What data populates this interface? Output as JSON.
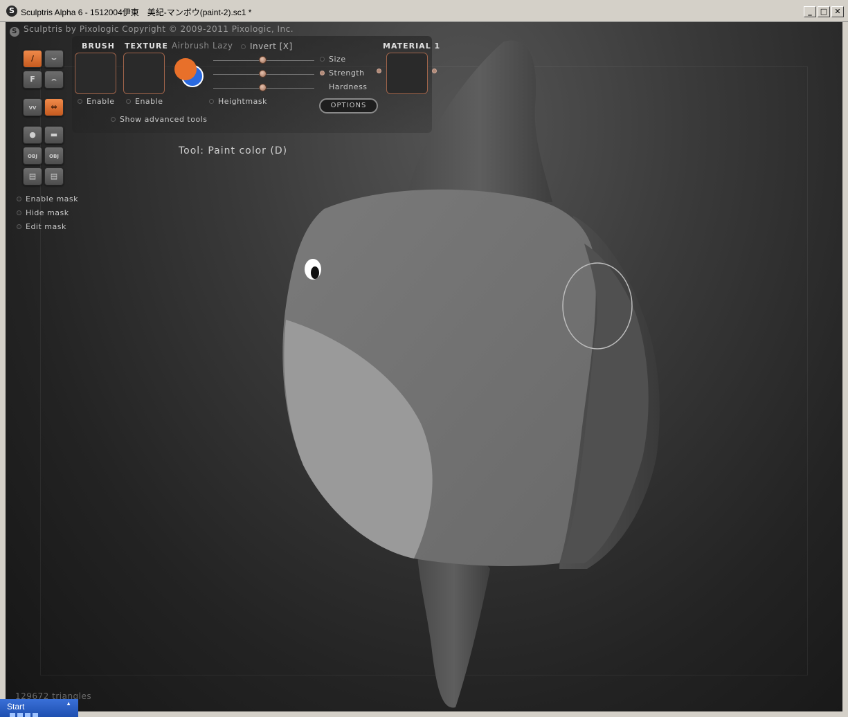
{
  "window": {
    "title": "Sculptris Alpha 6 - 1512004伊東　美紀-マンボウ(paint-2).sc1 *",
    "logo_glyph": "S",
    "minimize": "_",
    "maximize": "□",
    "close": "✕"
  },
  "header": {
    "copyright": "Sculptris by Pixologic   Copyright © 2009-2011 Pixologic, Inc.",
    "logo_glyph": "S"
  },
  "tools": {
    "brush_glyph": "/",
    "flatten_glyph": "F",
    "zig_glyph": "VV",
    "swap_glyph": "⇔",
    "sphere_glyph": "●",
    "plane_glyph": "▬",
    "import_label": "OBJ",
    "export_label": "OBJ",
    "save_glyph": "▤",
    "load_glyph": "▤"
  },
  "mask": {
    "enable": "Enable mask",
    "hide": "Hide mask",
    "edit": "Edit mask"
  },
  "panel": {
    "brush_label": "BRUSH",
    "texture_label": "TEXTURE",
    "airbrush_label": "Airbrush",
    "lazy_label": "Lazy",
    "invert_label": "Invert [X]",
    "brush_enable": "Enable",
    "texture_enable": "Enable",
    "heightmask": "Heightmask",
    "show_advanced": "Show advanced tools",
    "size_label": "Size",
    "strength_label": "Strength",
    "hardness_label": "Hardness",
    "options_label": "OPTIONS",
    "material_label": "MATERIAL 1",
    "primary_color": "#e8702a",
    "secondary_color": "#2a6ae0"
  },
  "status": {
    "tool": "Tool: Paint color (D)",
    "triangles": "129672 triangles"
  },
  "taskbar": {
    "start_label": "Start",
    "caret": "▲"
  }
}
